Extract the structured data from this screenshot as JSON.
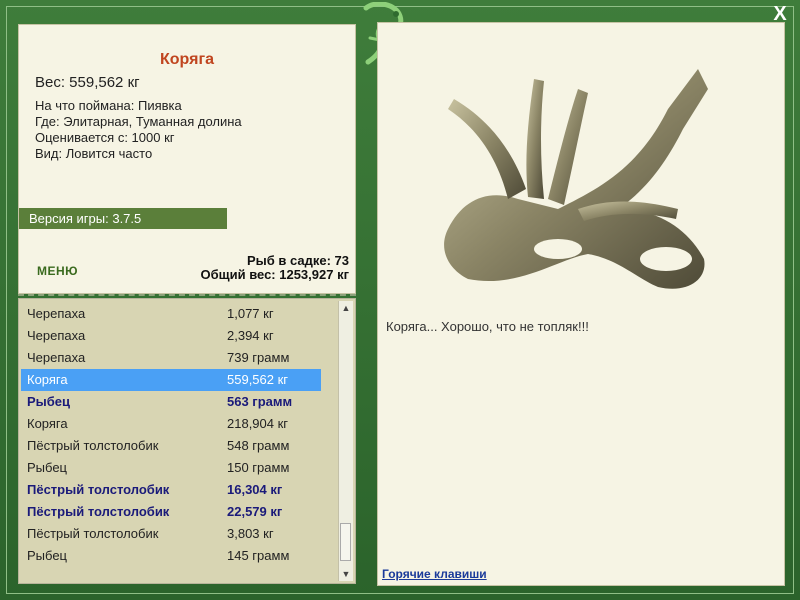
{
  "window": {
    "close_label": "X"
  },
  "info": {
    "title": "Коряга",
    "weight": "Вес: 559,562 кг",
    "caught_with": "На что поймана: Пиявка",
    "location": "Где: Элитарная, Туманная долина",
    "valued_from": "Оценивается с: 1000 кг",
    "kind": "Вид: Ловится часто"
  },
  "version": "Версия игры: 3.7.5",
  "menu_label": "МЕНЮ",
  "stats": {
    "fish_count": "Рыб в садке: 73",
    "total_weight": "Общий вес: 1253,927 кг"
  },
  "fish_list": [
    {
      "name": "Черепаха",
      "weight": "1,077 кг"
    },
    {
      "name": "Черепаха",
      "weight": "2,394 кг"
    },
    {
      "name": "Черепаха",
      "weight": "739 грамм"
    },
    {
      "name": "Коряга",
      "weight": "559,562 кг"
    },
    {
      "name": "Рыбец",
      "weight": "563 грамм"
    },
    {
      "name": "Коряга",
      "weight": "218,904 кг"
    },
    {
      "name": "Пёстрый толстолобик",
      "weight": "548 грамм"
    },
    {
      "name": "Рыбец",
      "weight": "150 грамм"
    },
    {
      "name": "Пёстрый толстолобик",
      "weight": "16,304 кг"
    },
    {
      "name": "Пёстрый толстолобик",
      "weight": "22,579 кг"
    },
    {
      "name": "Пёстрый толстолобик",
      "weight": "3,803 кг"
    },
    {
      "name": "Рыбец",
      "weight": "145 грамм"
    }
  ],
  "caption": "Коряга... Хорошо, что не топляк!!!",
  "hotkeys_label": "Горячие клавиши",
  "colors": {
    "frame": "#2f6b2f",
    "panel": "#f6f4e4",
    "list_bg": "#d8d5b3",
    "selected": "#4aa0f5",
    "title": "#c0451f",
    "bold_row": "#1a1a7a"
  }
}
